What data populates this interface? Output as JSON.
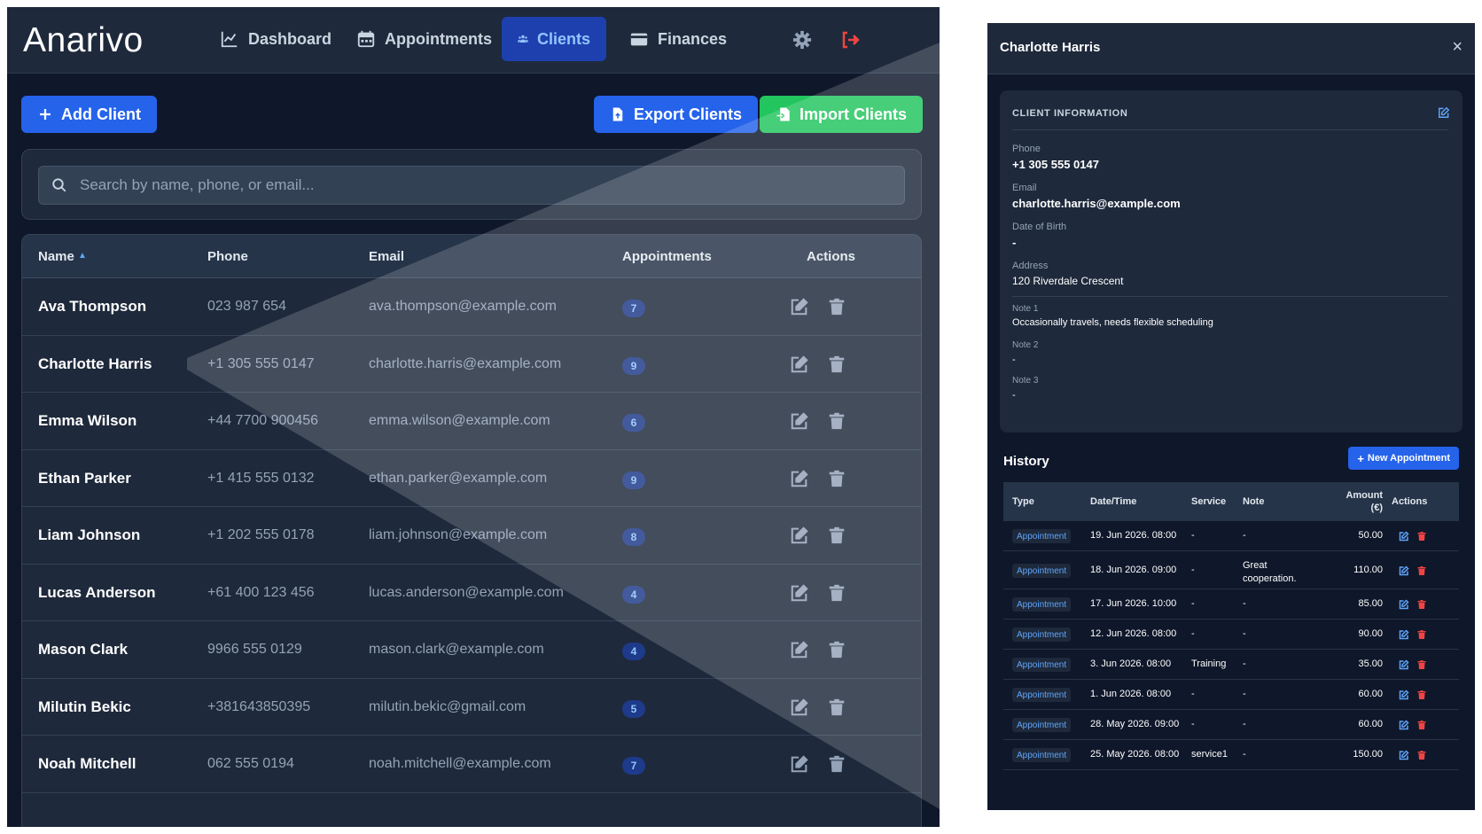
{
  "app": {
    "logo": "Anarivo",
    "nav": [
      {
        "label": "Dashboard",
        "icon": "chart-line-icon"
      },
      {
        "label": "Appointments",
        "icon": "calendar-icon"
      },
      {
        "label": "Clients",
        "icon": "users-icon",
        "active": true
      },
      {
        "label": "Finances",
        "icon": "wallet-icon"
      }
    ],
    "buttons": {
      "add_client": "Add Client",
      "export_clients": "Export Clients",
      "import_clients": "Import Clients"
    },
    "search": {
      "placeholder": "Search by name, phone, or email...",
      "value": ""
    },
    "table": {
      "columns": [
        "Name",
        "Phone",
        "Email",
        "Appointments",
        "Actions"
      ],
      "sorted_by": "Name",
      "rows": [
        {
          "name": "Ava Thompson",
          "phone": "023 987 654",
          "email": "ava.thompson@example.com",
          "appointments": "7"
        },
        {
          "name": "Charlotte Harris",
          "phone": "+1 305 555 0147",
          "email": "charlotte.harris@example.com",
          "appointments": "9"
        },
        {
          "name": "Emma Wilson",
          "phone": "+44 7700 900456",
          "email": "emma.wilson@example.com",
          "appointments": "6"
        },
        {
          "name": "Ethan Parker",
          "phone": "+1 415 555 0132",
          "email": "ethan.parker@example.com",
          "appointments": "9"
        },
        {
          "name": "Liam Johnson",
          "phone": "+1 202 555 0178",
          "email": "liam.johnson@example.com",
          "appointments": "8"
        },
        {
          "name": "Lucas Anderson",
          "phone": "+61 400 123 456",
          "email": "lucas.anderson@example.com",
          "appointments": "4"
        },
        {
          "name": "Mason Clark",
          "phone": "9966 555 0129",
          "email": "mason.clark@example.com",
          "appointments": "4"
        },
        {
          "name": "Milutin Bekic",
          "phone": "+381643850395",
          "email": "milutin.bekic@gmail.com",
          "appointments": "5"
        },
        {
          "name": "Noah Mitchell",
          "phone": "062 555 0194",
          "email": "noah.mitchell@example.com",
          "appointments": "7"
        }
      ]
    }
  },
  "panel": {
    "title": "Charlotte Harris",
    "close": "×",
    "info_heading": "CLIENT INFORMATION",
    "fields": {
      "phone_label": "Phone",
      "phone": "+1 305 555 0147",
      "email_label": "Email",
      "email": "charlotte.harris@example.com",
      "dob_label": "Date of Birth",
      "dob": "-",
      "address_label": "Address",
      "address": "120 Riverdale Crescent",
      "note1_label": "Note 1",
      "note1": "Occasionally travels, needs flexible scheduling",
      "note2_label": "Note 2",
      "note2": "-",
      "note3_label": "Note 3",
      "note3": "-"
    },
    "history_title": "History",
    "new_appointment": "New Appointment",
    "history_columns": {
      "type": "Type",
      "datetime": "Date/Time",
      "service": "Service",
      "note": "Note",
      "amount": "Amount",
      "amount_unit": "(€)",
      "actions": "Actions"
    },
    "history": [
      {
        "type": "Appointment",
        "datetime": "19. Jun 2026. 08:00",
        "service": "-",
        "note": "-",
        "amount": "50.00"
      },
      {
        "type": "Appointment",
        "datetime": "18. Jun 2026. 09:00",
        "service": "-",
        "note": "Great cooperation.",
        "amount": "110.00"
      },
      {
        "type": "Appointment",
        "datetime": "17. Jun 2026. 10:00",
        "service": "-",
        "note": "-",
        "amount": "85.00"
      },
      {
        "type": "Appointment",
        "datetime": "12. Jun 2026. 08:00",
        "service": "-",
        "note": "-",
        "amount": "90.00"
      },
      {
        "type": "Appointment",
        "datetime": "3. Jun 2026. 08:00",
        "service": "Training",
        "note": "-",
        "amount": "35.00"
      },
      {
        "type": "Appointment",
        "datetime": "1. Jun 2026. 08:00",
        "service": "-",
        "note": "-",
        "amount": "60.00"
      },
      {
        "type": "Appointment",
        "datetime": "28. May 2026. 09:00",
        "service": "-",
        "note": "-",
        "amount": "60.00"
      },
      {
        "type": "Appointment",
        "datetime": "25. May 2026. 08:00",
        "service": "service1",
        "note": "-",
        "amount": "150.00"
      }
    ]
  },
  "colors": {
    "background": "#0f172a",
    "card": "#1e293b",
    "primary": "#2563eb",
    "success": "#22c55e",
    "danger": "#ef4444",
    "accent_text": "#93c5fd"
  }
}
